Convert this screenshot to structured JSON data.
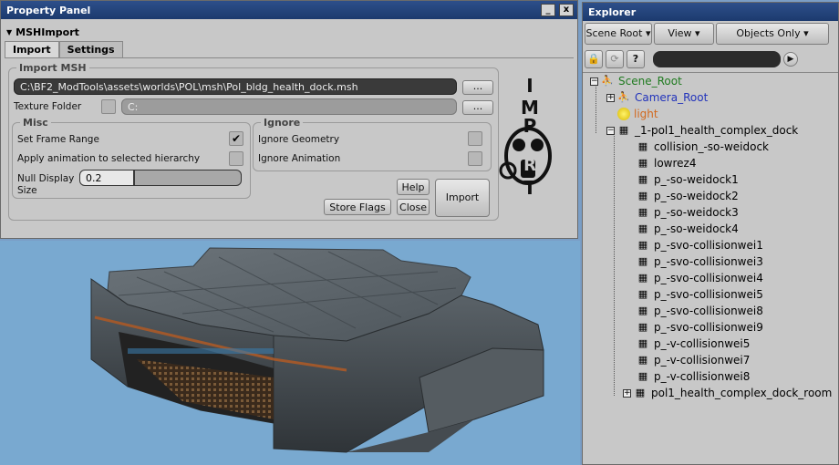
{
  "property_panel": {
    "title": "Property Panel",
    "min_btn": "_",
    "close_btn": "x",
    "section": "MSHImport",
    "tabs": [
      "Import",
      "Settings"
    ],
    "import_group": "Import MSH",
    "msh_path": "C:\\BF2_ModTools\\assets\\worlds\\POL\\msh\\Pol_bldg_health_dock.msh",
    "browse1": "...",
    "texture_folder_label": "Texture Folder",
    "texture_folder_value": "C:",
    "browse2": "...",
    "misc_label": "Misc",
    "set_frame_range": "Set Frame Range",
    "apply_anim": "Apply animation to selected hierarchy",
    "null_display_size": "Null Display\nSize",
    "null_display_value": "0.2",
    "ignore_label": "Ignore",
    "ignore_geometry": "Ignore Geometry",
    "ignore_animation": "Ignore Animation",
    "help_btn": "Help",
    "import_btn": "Import",
    "store_flags_btn": "Store Flags",
    "close_btn2": "Close",
    "logo_text": "IMPORT"
  },
  "explorer": {
    "title": "Explorer",
    "toolbar": {
      "scene_root": "Scene Root",
      "view": "View",
      "objects_only": "Objects Only"
    },
    "tree": [
      {
        "label": "Scene_Root",
        "color": "#1f7a1f"
      },
      {
        "label": "Camera_Root",
        "color": "#2233bb"
      },
      {
        "label": "light",
        "color": "#d2691e"
      },
      {
        "label": "_1-pol1_health_complex_dock",
        "color": "#000000"
      },
      {
        "label": "collision_-so-weidock",
        "color": "#000000"
      },
      {
        "label": "lowrez4",
        "color": "#000000"
      },
      {
        "label": "p_-so-weidock1",
        "color": "#000000"
      },
      {
        "label": "p_-so-weidock2",
        "color": "#000000"
      },
      {
        "label": "p_-so-weidock3",
        "color": "#000000"
      },
      {
        "label": "p_-so-weidock4",
        "color": "#000000"
      },
      {
        "label": "p_-svo-collisionwei1",
        "color": "#000000"
      },
      {
        "label": "p_-svo-collisionwei3",
        "color": "#000000"
      },
      {
        "label": "p_-svo-collisionwei4",
        "color": "#000000"
      },
      {
        "label": "p_-svo-collisionwei5",
        "color": "#000000"
      },
      {
        "label": "p_-svo-collisionwei8",
        "color": "#000000"
      },
      {
        "label": "p_-svo-collisionwei9",
        "color": "#000000"
      },
      {
        "label": "p_-v-collisionwei5",
        "color": "#000000"
      },
      {
        "label": "p_-v-collisionwei7",
        "color": "#000000"
      },
      {
        "label": "p_-v-collisionwei8",
        "color": "#000000"
      },
      {
        "label": "pol1_health_complex_dock_room",
        "color": "#000000"
      }
    ]
  }
}
